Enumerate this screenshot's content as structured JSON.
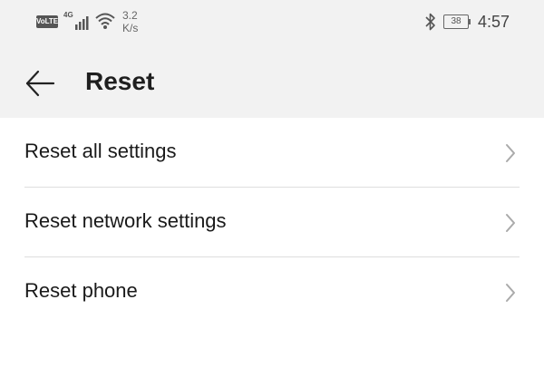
{
  "status_bar": {
    "volte": "VoLTE",
    "network_type": "4G",
    "speed_value": "3.2",
    "speed_unit": "K/s",
    "battery_level": "38",
    "time": "4:57",
    "icons": [
      "volte-icon",
      "signal-icon",
      "wifi-icon",
      "bluetooth-icon",
      "battery-icon"
    ]
  },
  "header": {
    "title": "Reset",
    "back_icon": "arrow-left-icon"
  },
  "list": {
    "items": [
      {
        "label": "Reset all settings"
      },
      {
        "label": "Reset network settings"
      },
      {
        "label": "Reset phone"
      }
    ],
    "item_icon": "chevron-right-icon"
  },
  "colors": {
    "header_bg": "#f2f2f2",
    "background": "#ffffff",
    "divider": "#dedede",
    "text": "#1a1a1a",
    "chevron": "#aaaaaa"
  }
}
